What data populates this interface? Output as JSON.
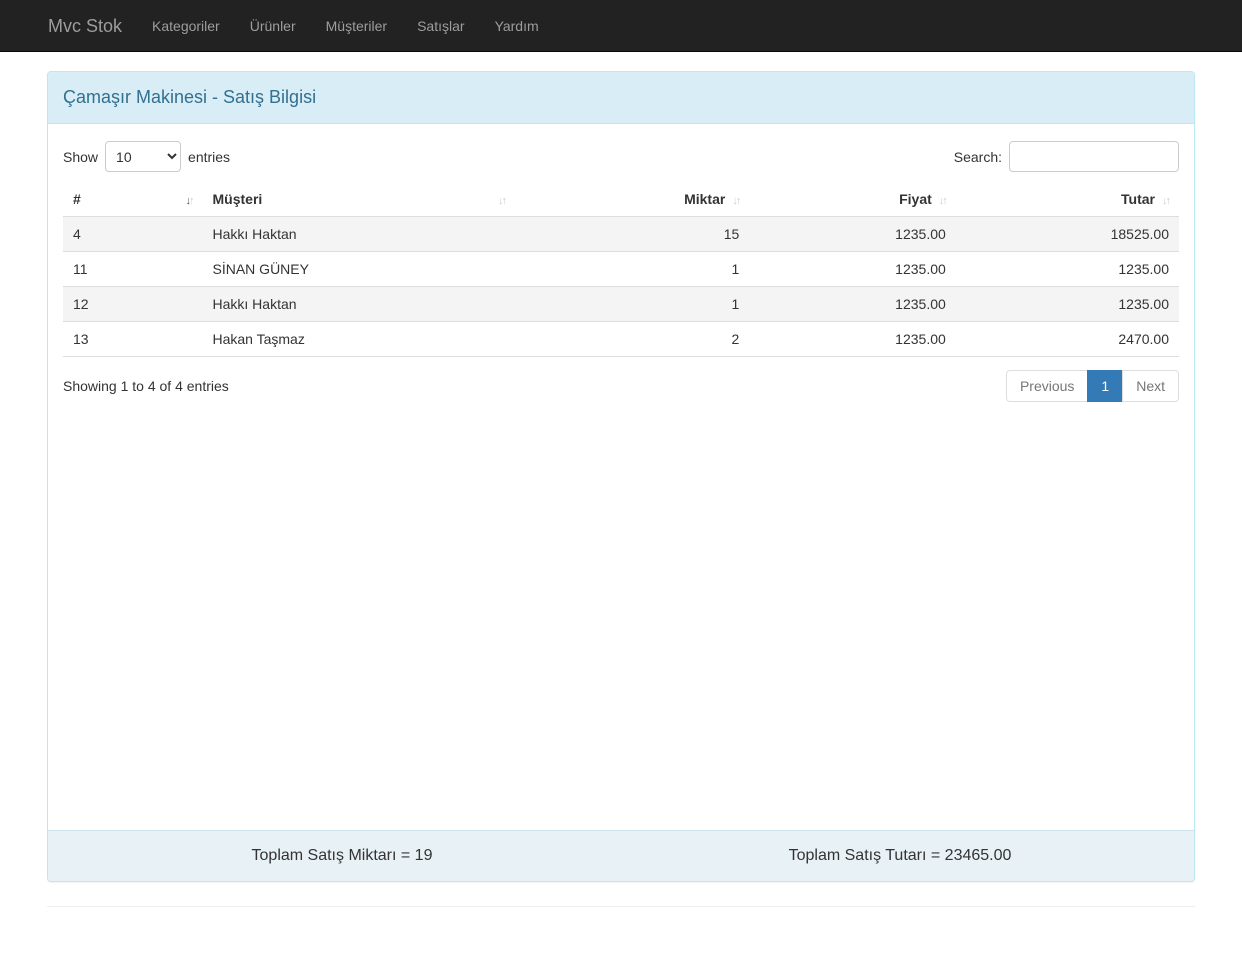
{
  "navbar": {
    "brand": "Mvc Stok",
    "items": [
      {
        "label": "Kategoriler"
      },
      {
        "label": "Ürünler"
      },
      {
        "label": "Müşteriler"
      },
      {
        "label": "Satışlar"
      },
      {
        "label": "Yardım"
      }
    ]
  },
  "panel": {
    "title": "Çamaşır Makinesi - Satış Bilgisi",
    "footer_total_quantity": "Toplam Satış Miktarı = 19",
    "footer_total_amount": "Toplam Satış Tutarı = 23465.00"
  },
  "table_controls": {
    "show_label": "Show",
    "page_length": "10",
    "entries_label": "entries",
    "search_label": "Search:",
    "search_value": ""
  },
  "table": {
    "columns": [
      "#",
      "Müşteri",
      "Miktar",
      "Fiyat",
      "Tutar"
    ],
    "rows": [
      [
        "4",
        "Hakkı Haktan",
        "15",
        "1235.00",
        "18525.00"
      ],
      [
        "11",
        "SİNAN GÜNEY",
        "1",
        "1235.00",
        "1235.00"
      ],
      [
        "12",
        "Hakkı Haktan",
        "1",
        "1235.00",
        "1235.00"
      ],
      [
        "13",
        "Hakan Taşmaz",
        "2",
        "1235.00",
        "2470.00"
      ]
    ],
    "info": "Showing 1 to 4 of 4 entries"
  },
  "pagination": {
    "previous": "Previous",
    "current": "1",
    "next": "Next"
  },
  "colors": {
    "navbar_bg": "#222222",
    "navbar_text": "#9d9d9d",
    "panel_border": "#bce8f1",
    "panel_heading_bg": "#d9edf7",
    "panel_heading_text": "#31708f",
    "panel_footer_bg": "#e8f1f5",
    "active_page_bg": "#337ab7",
    "row_stripe": "#f4f4f4"
  }
}
